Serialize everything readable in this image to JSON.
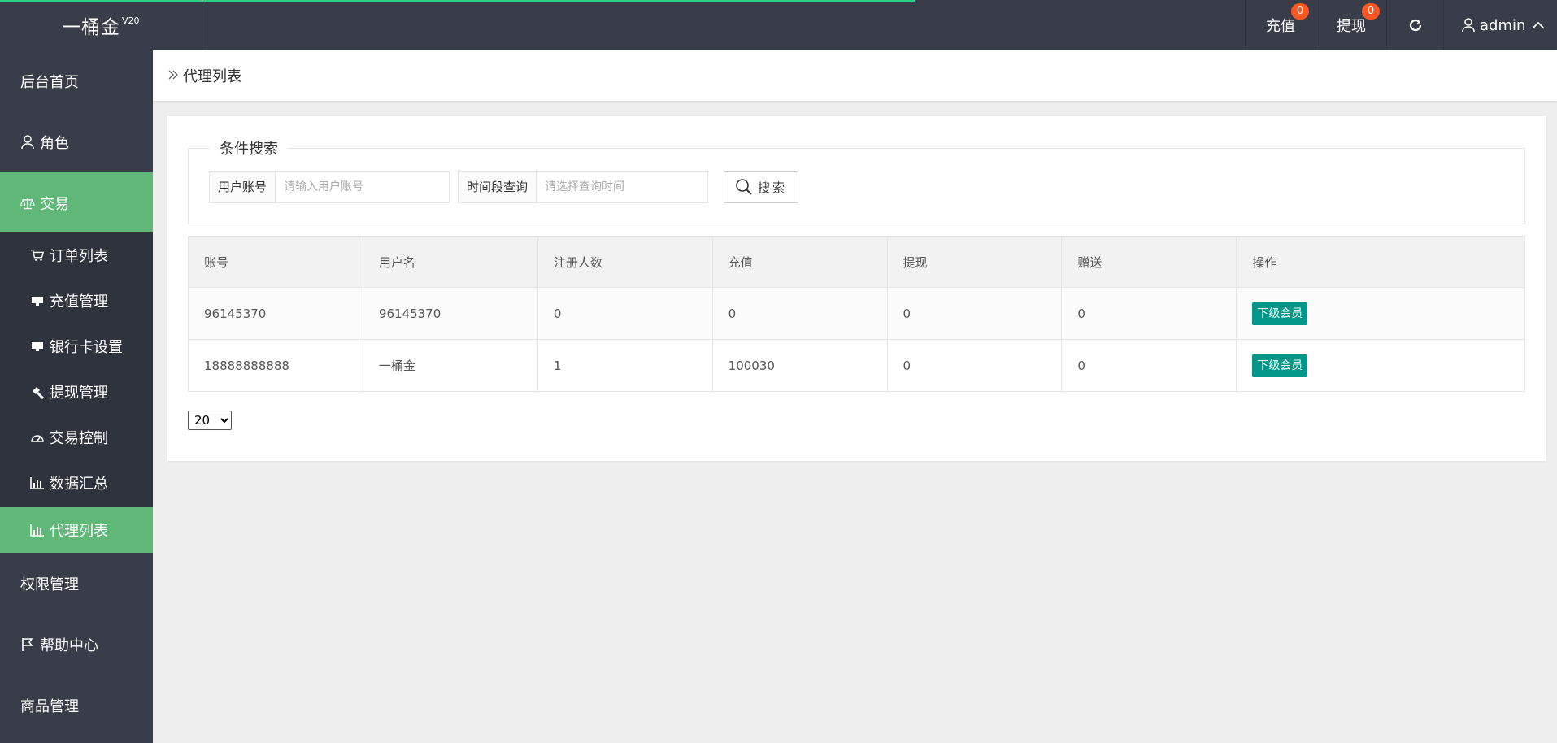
{
  "app": {
    "name": "一桶金",
    "version": "V20"
  },
  "header": {
    "recharge": {
      "label": "充值",
      "count": "0"
    },
    "withdraw": {
      "label": "提现",
      "count": "0"
    },
    "user": "admin"
  },
  "sidebar": {
    "items": [
      {
        "label": "后台首页"
      },
      {
        "label": "角色"
      },
      {
        "label": "交易"
      },
      {
        "label": "权限管理"
      },
      {
        "label": "帮助中心"
      },
      {
        "label": "商品管理"
      }
    ],
    "sub": [
      {
        "label": "订单列表"
      },
      {
        "label": "充值管理"
      },
      {
        "label": "银行卡设置"
      },
      {
        "label": "提现管理"
      },
      {
        "label": "交易控制"
      },
      {
        "label": "数据汇总"
      },
      {
        "label": "代理列表"
      }
    ]
  },
  "breadcrumb": {
    "title": "代理列表"
  },
  "search": {
    "legend": "条件搜索",
    "account_label": "用户账号",
    "account_placeholder": "请输入用户账号",
    "time_label": "时间段查询",
    "time_placeholder": "请选择查询时间",
    "button": "搜索"
  },
  "table": {
    "headers": [
      "账号",
      "用户名",
      "注册人数",
      "充值",
      "提现",
      "赠送",
      "操作"
    ],
    "rows": [
      [
        "96145370",
        "96145370",
        "0",
        "0",
        "0",
        "0",
        "下级会员"
      ],
      [
        "18888888888",
        "一桶金",
        "1",
        "100030",
        "0",
        "0",
        "下级会员"
      ]
    ]
  },
  "pagination": {
    "page_size": "20"
  },
  "colors": {
    "sidebar": "#393d49",
    "active": "#5fb878",
    "button": "#009688",
    "badge": "#ff5722"
  }
}
